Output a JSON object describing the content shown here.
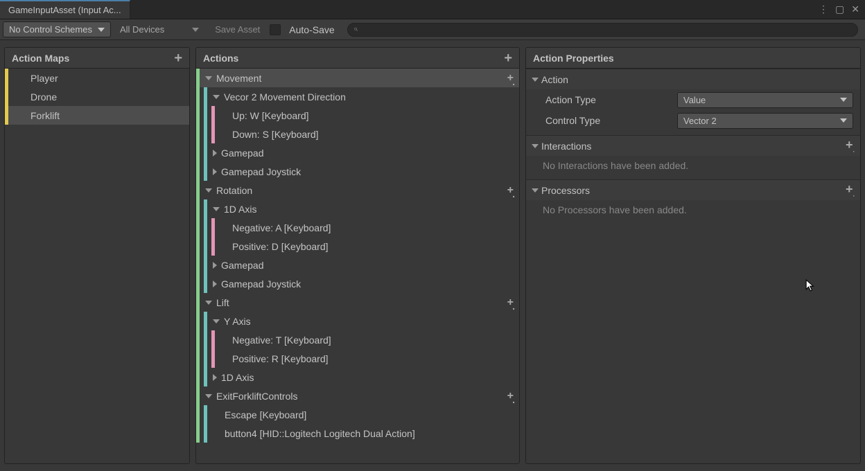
{
  "window": {
    "tab_title": "GameInputAsset (Input Ac..."
  },
  "toolbar": {
    "control_schemes": "No Control Schemes",
    "devices": "All Devices",
    "save_btn": "Save Asset",
    "auto_save": "Auto-Save",
    "search_placeholder": ""
  },
  "maps": {
    "header": "Action Maps",
    "items": [
      {
        "label": "Player",
        "selected": false
      },
      {
        "label": "Drone",
        "selected": false
      },
      {
        "label": "Forklift",
        "selected": true
      }
    ]
  },
  "actions": {
    "header": "Actions",
    "tree": [
      {
        "depth": 0,
        "color": "c-green",
        "arrow": "down",
        "label": "Movement",
        "plus": "sub",
        "selected": true
      },
      {
        "depth": 1,
        "color": "c-teal",
        "arrow": "down",
        "label": "Vecor 2 Movement Direction"
      },
      {
        "depth": 2,
        "color": "c-pink",
        "arrow": "none",
        "label": "Up: W [Keyboard]"
      },
      {
        "depth": 2,
        "color": "c-pink",
        "arrow": "none",
        "label": "Down: S [Keyboard]"
      },
      {
        "depth": 1,
        "color": "c-teal",
        "arrow": "right",
        "label": "Gamepad"
      },
      {
        "depth": 1,
        "color": "c-teal",
        "arrow": "right",
        "label": "Gamepad Joystick"
      },
      {
        "depth": 0,
        "color": "c-green",
        "arrow": "down",
        "label": "Rotation",
        "plus": "sub"
      },
      {
        "depth": 1,
        "color": "c-teal",
        "arrow": "down",
        "label": "1D Axis"
      },
      {
        "depth": 2,
        "color": "c-pink",
        "arrow": "none",
        "label": "Negative: A [Keyboard]"
      },
      {
        "depth": 2,
        "color": "c-pink",
        "arrow": "none",
        "label": "Positive: D [Keyboard]"
      },
      {
        "depth": 1,
        "color": "c-teal",
        "arrow": "right",
        "label": "Gamepad"
      },
      {
        "depth": 1,
        "color": "c-teal",
        "arrow": "right",
        "label": "Gamepad Joystick"
      },
      {
        "depth": 0,
        "color": "c-green",
        "arrow": "down",
        "label": "Lift",
        "plus": "sub"
      },
      {
        "depth": 1,
        "color": "c-teal",
        "arrow": "down",
        "label": "Y Axis"
      },
      {
        "depth": 2,
        "color": "c-pink",
        "arrow": "none",
        "label": "Negative: T [Keyboard]"
      },
      {
        "depth": 2,
        "color": "c-pink",
        "arrow": "none",
        "label": "Positive: R [Keyboard]"
      },
      {
        "depth": 1,
        "color": "c-teal",
        "arrow": "right",
        "label": "1D Axis"
      },
      {
        "depth": 0,
        "color": "c-green",
        "arrow": "down",
        "label": "ExitForkliftControls",
        "plus": "sub"
      },
      {
        "depth": 1,
        "color": "c-teal",
        "arrow": "none",
        "label": "Escape [Keyboard]"
      },
      {
        "depth": 1,
        "color": "c-teal",
        "arrow": "none",
        "label": "button4 [HID::Logitech Logitech Dual Action]"
      }
    ]
  },
  "properties": {
    "header": "Action Properties",
    "action_section": "Action",
    "action_type_label": "Action Type",
    "action_type_value": "Value",
    "control_type_label": "Control Type",
    "control_type_value": "Vector 2",
    "interactions_section": "Interactions",
    "interactions_empty": "No Interactions have been added.",
    "processors_section": "Processors",
    "processors_empty": "No Processors have been added."
  }
}
